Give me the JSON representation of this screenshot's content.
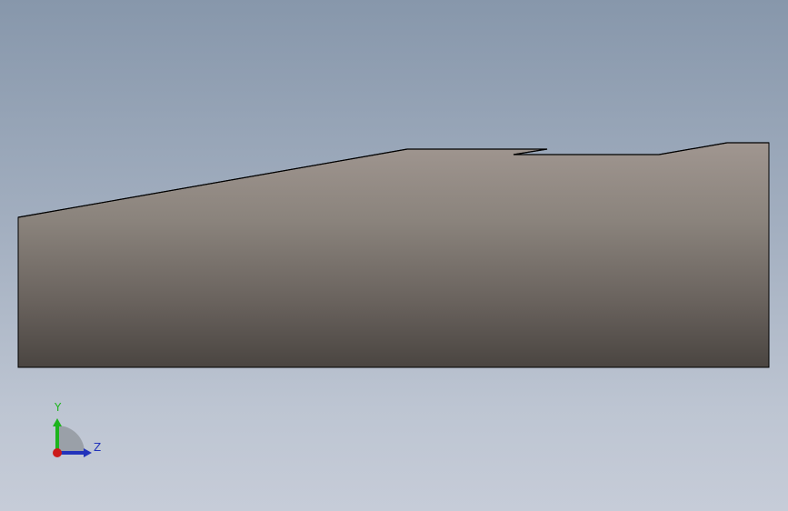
{
  "viewport": {
    "background_top": "#8797ab",
    "background_bottom": "#c6ccd8"
  },
  "part": {
    "face_color_top": "#9a8f88",
    "face_color_bottom": "#4a4541",
    "edge_color": "#000000"
  },
  "triad": {
    "y_label": "Y",
    "z_label": "Z",
    "y_color": "#1db41d",
    "z_color": "#2233bb",
    "x_color": "#cc1a1a"
  }
}
